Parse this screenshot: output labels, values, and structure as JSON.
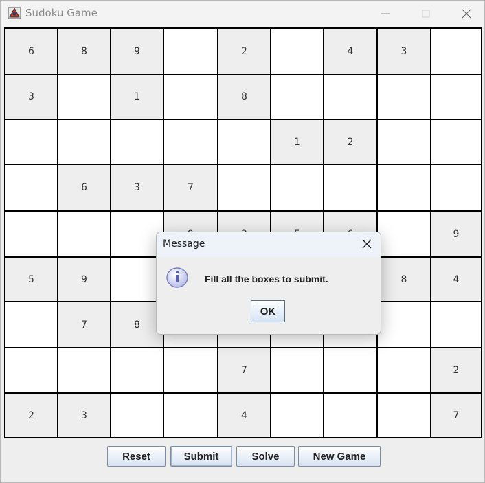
{
  "window": {
    "title": "Sudoku Game"
  },
  "board": [
    [
      "6",
      "8",
      "9",
      "",
      "2",
      "",
      "4",
      "3",
      ""
    ],
    [
      "3",
      "",
      "1",
      "",
      "8",
      "",
      "",
      "",
      ""
    ],
    [
      "",
      "",
      "",
      "",
      "",
      "1",
      "2",
      "",
      ""
    ],
    [
      "",
      "6",
      "3",
      "7",
      "",
      "",
      "",
      "",
      ""
    ],
    [
      "",
      "",
      "",
      "9",
      "3",
      "5",
      "6",
      "",
      "9"
    ],
    [
      "5",
      "9",
      "",
      "",
      "",
      "",
      "",
      "8",
      "4"
    ],
    [
      "",
      "7",
      "8",
      "",
      "",
      "",
      "",
      "",
      ""
    ],
    [
      "",
      "",
      "",
      "",
      "7",
      "",
      "",
      "",
      "2"
    ],
    [
      "2",
      "3",
      "",
      "",
      "4",
      "",
      "",
      "",
      "7"
    ]
  ],
  "given": [
    [
      1,
      1,
      1,
      0,
      1,
      0,
      1,
      1,
      0
    ],
    [
      1,
      0,
      1,
      0,
      1,
      0,
      0,
      0,
      0
    ],
    [
      0,
      0,
      0,
      0,
      0,
      1,
      1,
      0,
      0
    ],
    [
      0,
      1,
      1,
      1,
      0,
      0,
      0,
      0,
      0
    ],
    [
      0,
      0,
      0,
      1,
      1,
      1,
      1,
      0,
      1
    ],
    [
      1,
      1,
      0,
      0,
      0,
      0,
      0,
      1,
      1
    ],
    [
      0,
      1,
      1,
      0,
      0,
      0,
      0,
      0,
      0
    ],
    [
      0,
      0,
      0,
      0,
      1,
      0,
      0,
      0,
      1
    ],
    [
      1,
      1,
      0,
      0,
      1,
      0,
      0,
      0,
      1
    ]
  ],
  "buttons": {
    "reset": "Reset",
    "submit": "Submit",
    "solve": "Solve",
    "new_game": "New Game"
  },
  "dialog": {
    "title": "Message",
    "message": "Fill all the boxes to submit.",
    "ok": "OK"
  },
  "icons": {
    "app": "sudoku-app-icon",
    "minimize": "minimize-icon",
    "maximize": "maximize-icon",
    "close": "close-icon",
    "info": "information-icon"
  },
  "colors": {
    "given_cell": "#eeeeee",
    "empty_cell": "#ffffff",
    "grid_line": "#000000",
    "button_gradient_top": "#ffffff",
    "button_gradient_bottom": "#d7e3f1"
  }
}
